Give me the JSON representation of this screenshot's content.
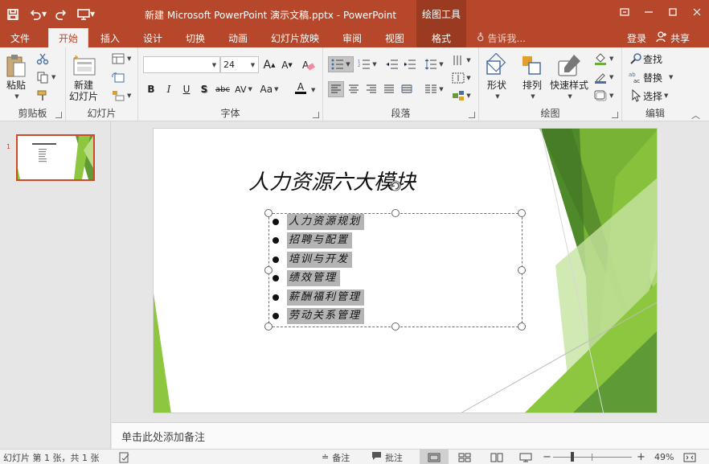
{
  "titlebar": {
    "title": "新建 Microsoft PowerPoint 演示文稿.pptx - PowerPoint",
    "tool_group": "绘图工具"
  },
  "tabs": [
    {
      "label": "文件"
    },
    {
      "label": "开始"
    },
    {
      "label": "插入"
    },
    {
      "label": "设计"
    },
    {
      "label": "切换"
    },
    {
      "label": "动画"
    },
    {
      "label": "幻灯片放映"
    },
    {
      "label": "审阅"
    },
    {
      "label": "视图"
    },
    {
      "label": "格式"
    }
  ],
  "tell_me": "告诉我...",
  "account": {
    "login": "登录",
    "share": "共享"
  },
  "ribbon": {
    "clipboard": {
      "label": "剪贴板",
      "paste": "粘贴"
    },
    "slides": {
      "label": "幻灯片",
      "new_line1": "新建",
      "new_line2": "幻灯片"
    },
    "font": {
      "label": "字体",
      "font_name": "",
      "font_size": "24"
    },
    "paragraph": {
      "label": "段落"
    },
    "drawing": {
      "label": "绘图",
      "shape": "形状",
      "arrange": "排列",
      "quick_style": "快速样式"
    },
    "editing": {
      "label": "编辑",
      "find": "查找",
      "replace": "替换",
      "select": "选择"
    }
  },
  "thumbnail": {
    "number": "1"
  },
  "slide": {
    "title": "人力资源六大模块",
    "bullets": [
      "人力资源规划",
      "招聘与配置",
      "培训与开发",
      "绩效管理",
      "薪酬福利管理",
      "劳动关系管理"
    ]
  },
  "notes_placeholder": "单击此处添加备注",
  "status": {
    "slide_info": "幻灯片 第 1 张，共 1 张",
    "notes": "备注",
    "comments": "批注",
    "zoom": "49%"
  },
  "colors": {
    "brand": "#b7472a",
    "green": "#8dc63f"
  }
}
